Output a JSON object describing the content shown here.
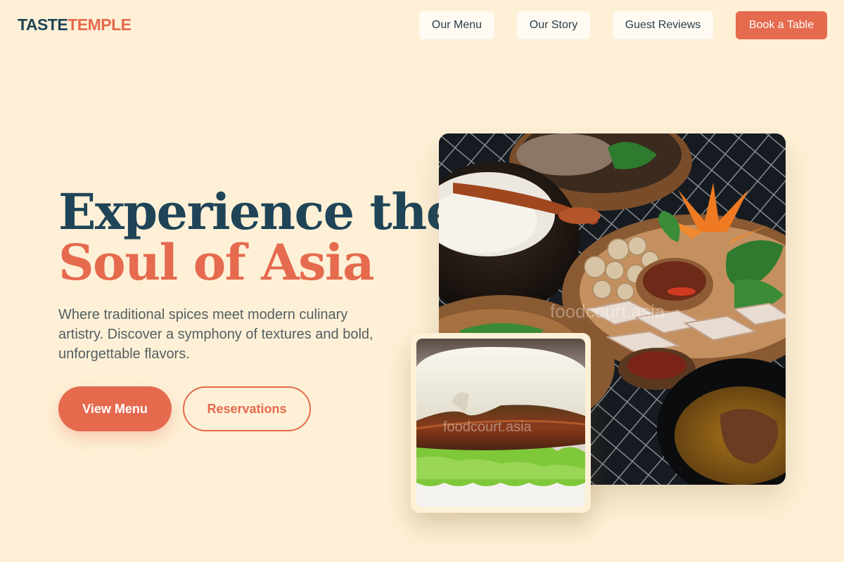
{
  "header": {
    "logo_part1": "TASTE",
    "logo_part2": "TEMPLE",
    "nav": [
      {
        "label": "Our Menu"
      },
      {
        "label": "Our Story"
      },
      {
        "label": "Guest Reviews"
      }
    ],
    "cta_label": "Book a Table"
  },
  "hero": {
    "title_line1": "Experience the",
    "title_line2": "Soul of Asia",
    "subtitle": "Where traditional spices meet modern culinary artistry. Discover a symphony of textures and bold, unforgettable flavors.",
    "primary_button": "View Menu",
    "secondary_button": "Reservations"
  },
  "images": {
    "main_watermark": "foodcourt.asia",
    "inset_watermark": "foodcourt.asia"
  },
  "colors": {
    "background": "#fdf0d6",
    "navy": "#1f4457",
    "accent": "#e56a4e"
  }
}
